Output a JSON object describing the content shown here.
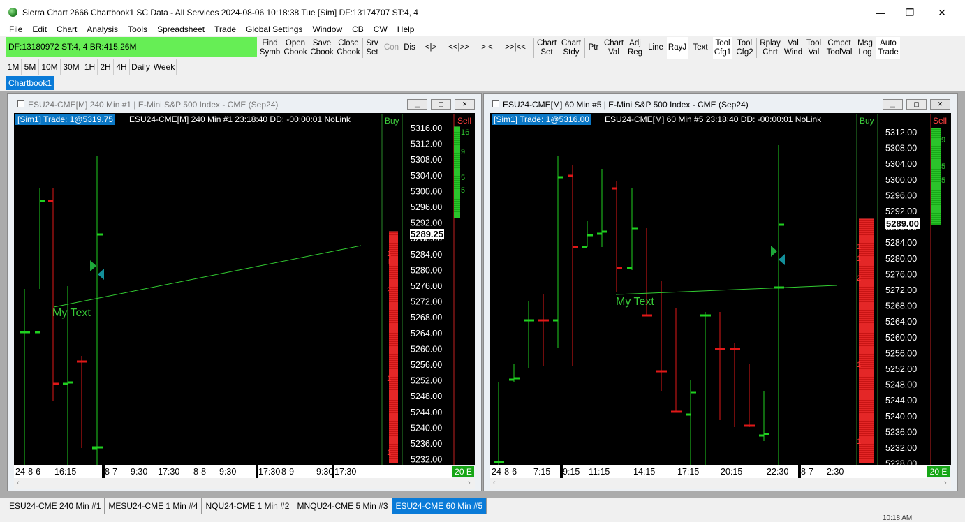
{
  "window": {
    "title": "Sierra Chart 2666 Chartbook1 SC Data - All Services 2024-08-06  10:18:38 Tue [Sim] DF:13174707  ST:4, 4",
    "minimize": "—",
    "maximize": "❐",
    "close": "✕"
  },
  "menu": [
    "File",
    "Edit",
    "Chart",
    "Analysis",
    "Tools",
    "Spreadsheet",
    "Trade",
    "Global Settings",
    "Window",
    "CB",
    "CW",
    "Help"
  ],
  "status": {
    "df": "DF:13180972  ST:4, 4  BR:415.26M"
  },
  "toolbar": {
    "find": [
      "Find",
      "Symb"
    ],
    "open": [
      "Open",
      "Cbook"
    ],
    "save": [
      "Save",
      "Cbook"
    ],
    "closecb": [
      "Close",
      "Cbook"
    ],
    "srv": [
      "Srv",
      "Set"
    ],
    "con": "Con",
    "dis": "Dis",
    "nav1": "<|>",
    "nav2": "<<|>>",
    "nav3": ">|<",
    "nav4": ">>|<<",
    "chartset": [
      "Chart",
      "Set"
    ],
    "chartstdy": [
      "Chart",
      "Stdy"
    ],
    "ptr": "Ptr",
    "chartval": [
      "Chart",
      "Val"
    ],
    "adjreg": [
      "Adj",
      "Reg"
    ],
    "line": "Line",
    "rayj": "RayJ",
    "text": "Text",
    "toolcfg1": [
      "Tool",
      "Cfg1"
    ],
    "toolcfg2": [
      "Tool",
      "Cfg2"
    ],
    "rplay": [
      "Rplay",
      "Chrt"
    ],
    "valwind": [
      "Val",
      "Wind"
    ],
    "toolval": [
      "Tool",
      "Val"
    ],
    "cmpct": [
      "Cmpct",
      "ToolVal"
    ],
    "msglog": [
      "Msg",
      "Log"
    ],
    "autotrade": [
      "Auto",
      "Trade"
    ]
  },
  "timeframes": [
    "1M",
    "5M",
    "10M",
    "30M",
    "1H",
    "2H",
    "4H",
    "Daily",
    "Week"
  ],
  "chartbook_tab": "Chartbook1",
  "chart1": {
    "title": "ESU24-CME[M]  240 Min  #1 | E-Mini S&P 500 Index - CME (Sep24)",
    "sim": "[Sim1]  Trade: 1@5319.75",
    "info": "ESU24-CME[M]  240 Min  #1 23:18:40 DD: -00:00:01 NoLink",
    "buy": "Buy",
    "sell": "Sell",
    "current_price": "5289.25",
    "text_note": "My Text",
    "badge": "20 E",
    "prices": [
      "5316.00",
      "5312.00",
      "5308.00",
      "5304.00",
      "5300.00",
      "5296.00",
      "5292.00",
      "5288.00",
      "5284.00",
      "5280.00",
      "5276.00",
      "5272.00",
      "5268.00",
      "5264.00",
      "5260.00",
      "5256.00",
      "5252.00",
      "5248.00",
      "5244.00",
      "5240.00",
      "5236.00",
      "5232.00"
    ],
    "time_labels": [
      "24-8-6",
      "16:15",
      "8-7",
      "9:30",
      "17:30",
      "8-8",
      "9:30",
      "17:30",
      "8-9",
      "9:30",
      "17:30"
    ],
    "dom_sell_numbers": [
      "1",
      "1",
      "2",
      "1",
      "1"
    ],
    "dom_buy_numbers": [
      "16",
      "9",
      "5",
      "5"
    ]
  },
  "chart2": {
    "title": "ESU24-CME[M]  60 Min  #5 | E-Mini S&P 500 Index - CME (Sep24)",
    "sim": "[Sim1]  Trade: 1@5316.00",
    "info": "ESU24-CME[M]  60 Min  #5 23:18:40 DD: -00:00:01 NoLink",
    "buy": "Buy",
    "sell": "Sell",
    "current_price": "5289.00",
    "text_note": "My Text",
    "badge": "20 E",
    "prices": [
      "5312.00",
      "5308.00",
      "5304.00",
      "5300.00",
      "5296.00",
      "5292.00",
      "5288.00",
      "5284.00",
      "5280.00",
      "5276.00",
      "5272.00",
      "5268.00",
      "5264.00",
      "5260.00",
      "5256.00",
      "5252.00",
      "5248.00",
      "5244.00",
      "5240.00",
      "5236.00",
      "5232.00",
      "5228.00"
    ],
    "time_labels": [
      "24-8-6",
      "7:15",
      "9:15",
      "11:15",
      "14:15",
      "17:15",
      "20:15",
      "22:30",
      "8-7",
      "2:30"
    ],
    "dom_sell_numbers": [
      "1",
      "1",
      "2",
      "1",
      "1"
    ],
    "dom_buy_numbers": [
      "9",
      "5",
      "5"
    ]
  },
  "bottom_tabs": [
    "ESU24-CME  240 Min  #1",
    "MESU24-CME  1 Min  #4",
    "NQU24-CME  1 Min  #2",
    "MNQU24-CME  5 Min  #3",
    "ESU24-CME  60 Min  #5"
  ],
  "taskbar_clock": "10:18 AM",
  "colors": {
    "up": "#20d020",
    "down": "#e01818",
    "trendline": "#32cd32",
    "sim_bg": "#0b78c6",
    "status_green": "#66ee55"
  }
}
